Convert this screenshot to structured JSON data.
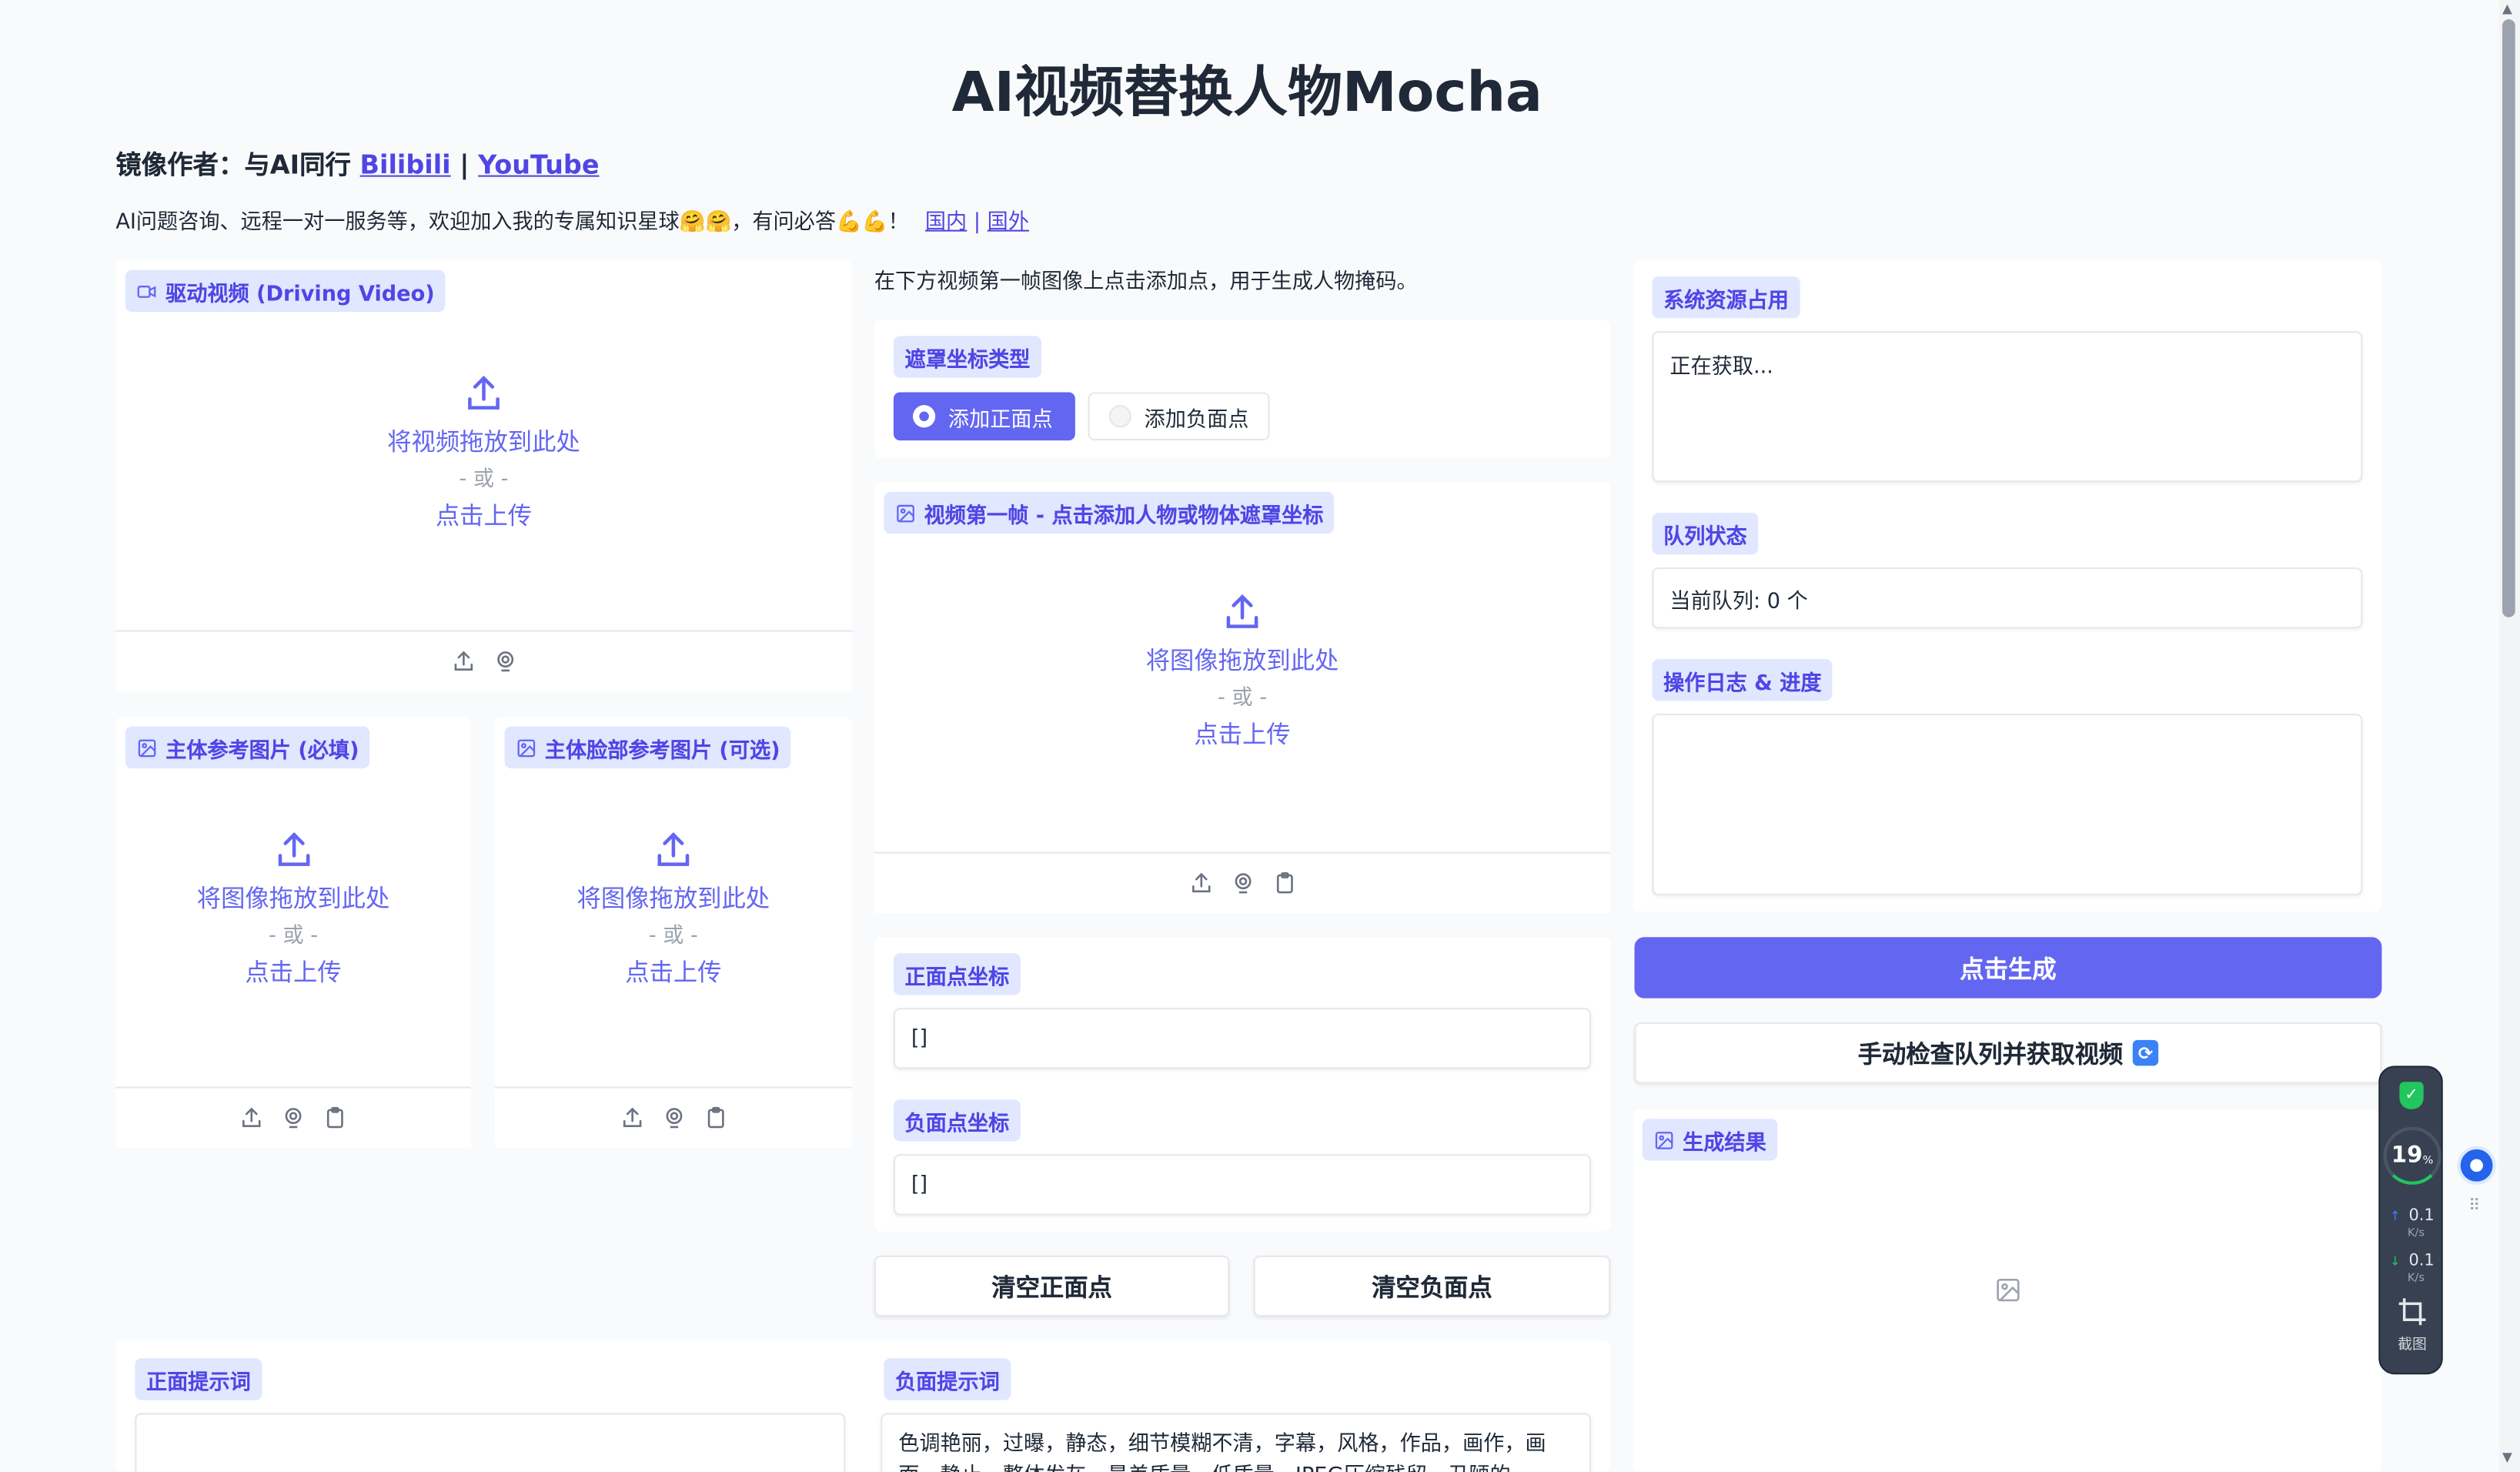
{
  "title": "AI视频替换人物Mocha",
  "author": {
    "prefix": "镜像作者：与AI同行",
    "bilibili": "Bilibili",
    "sep": "|",
    "youtube": "YouTube"
  },
  "promo": {
    "text": "AI问题咨询、远程一对一服务等，欢迎加入我的专属知识星球🤗🤗，有问必答💪💪！",
    "link_cn": "国内",
    "sep": "|",
    "link_intl": "国外"
  },
  "upload": {
    "drop_video": "将视频拖放到此处",
    "drop_image": "将图像拖放到此处",
    "or": "- 或 -",
    "click": "点击上传"
  },
  "driving_video": {
    "label": "驱动视频 (Driving Video)"
  },
  "ref_image": {
    "label": "主体参考图片 (必填)"
  },
  "face_image": {
    "label": "主体脸部参考图片 (可选)"
  },
  "instruction": "在下方视频第一帧图像上点击添加点，用于生成人物掩码。",
  "mask_type": {
    "label": "遮罩坐标类型",
    "options": [
      "添加正面点",
      "添加负面点"
    ],
    "selected": "添加正面点"
  },
  "first_frame": {
    "label": "视频第一帧 - 点击添加人物或物体遮罩坐标"
  },
  "positive_coords": {
    "label": "正面点坐标",
    "value": "[]"
  },
  "negative_coords": {
    "label": "负面点坐标",
    "value": "[]"
  },
  "buttons": {
    "clear_positive": "清空正面点",
    "clear_negative": "清空负面点",
    "generate": "点击生成",
    "check_queue": "手动检查队列并获取视频",
    "check_queue_emoji": "🔄"
  },
  "system": {
    "label": "系统资源占用",
    "value": "正在获取..."
  },
  "queue": {
    "label": "队列状态",
    "value": "当前队列: 0 个"
  },
  "log": {
    "label": "操作日志 & 进度",
    "value": ""
  },
  "result": {
    "label": "生成结果"
  },
  "positive_prompt": {
    "label": "正面提示词",
    "value": ""
  },
  "negative_prompt": {
    "label": "负面提示词",
    "value": "色调艳丽，过曝，静态，细节模糊不清，字幕，风格，作品，画作，画面，静止，整体发灰，最差质量，低质量，JPEG压缩残留，丑陋的"
  },
  "widget": {
    "percent": "19",
    "percent_unit": "%",
    "up_speed": "0.1",
    "down_speed": "0.1",
    "speed_unit": "K/s",
    "screenshot": "截图"
  },
  "colors": {
    "accent": "#6366f1",
    "tag_bg": "#e0e7ff",
    "tag_text": "#4f46e5",
    "widget_bg": "#374151",
    "widget_green": "#22c55e"
  }
}
